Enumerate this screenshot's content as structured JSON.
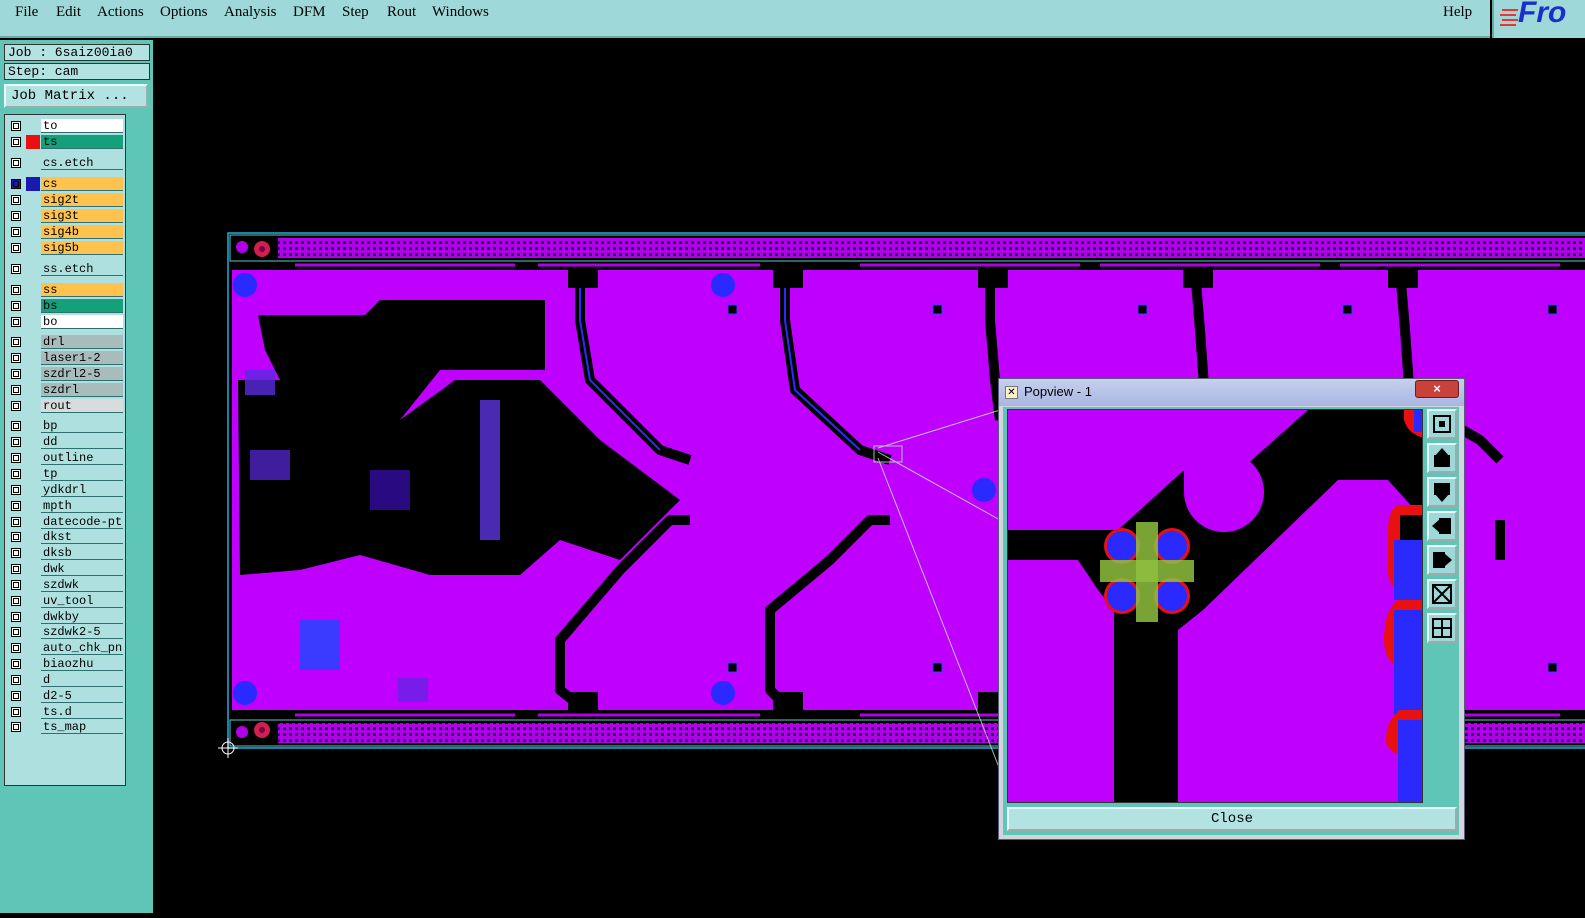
{
  "menubar": {
    "items": [
      {
        "label": "File"
      },
      {
        "label": "Edit"
      },
      {
        "label": "Actions"
      },
      {
        "label": "Options"
      },
      {
        "label": "Analysis"
      },
      {
        "label": "DFM"
      },
      {
        "label": "Step"
      },
      {
        "label": "Rout"
      },
      {
        "label": "Windows"
      }
    ],
    "help": "Help",
    "logo_text": "Fro"
  },
  "left_panel": {
    "job_label": "Job : 6saiz00ia0",
    "step_label": "Step: cam",
    "job_matrix_button": "Job Matrix ..."
  },
  "layers": [
    {
      "name": "to",
      "color": "#ffffff"
    },
    {
      "name": "ts",
      "color": "#13a07a"
    },
    {
      "name": "cs.etch",
      "color": "#aee0e0"
    },
    {
      "name": "cs",
      "color": "#ffc24d"
    },
    {
      "name": "sig2t",
      "color": "#ffc24d"
    },
    {
      "name": "sig3t",
      "color": "#ffc24d"
    },
    {
      "name": "sig4b",
      "color": "#ffc24d"
    },
    {
      "name": "sig5b",
      "color": "#ffc24d"
    },
    {
      "name": "ss.etch",
      "color": "#aee0e0"
    },
    {
      "name": "ss",
      "color": "#ffc24d"
    },
    {
      "name": "bs",
      "color": "#13a07a"
    },
    {
      "name": "bo",
      "color": "#ffffff"
    },
    {
      "name": "drl",
      "color": "#a9bcbc"
    },
    {
      "name": "laser1-2",
      "color": "#a9bcbc"
    },
    {
      "name": "szdrl2-5",
      "color": "#a9bcbc"
    },
    {
      "name": "szdrl",
      "color": "#a9bcbc"
    },
    {
      "name": "rout",
      "color": "#d9dcdc"
    },
    {
      "name": "bp",
      "color": "#aee0e0"
    },
    {
      "name": "dd",
      "color": "#aee0e0"
    },
    {
      "name": "outline",
      "color": "#aee0e0"
    },
    {
      "name": "tp",
      "color": "#aee0e0"
    },
    {
      "name": "ydkdrl",
      "color": "#aee0e0"
    },
    {
      "name": "mpth",
      "color": "#aee0e0"
    },
    {
      "name": "datecode-ptc",
      "color": "#aee0e0"
    },
    {
      "name": "dkst",
      "color": "#aee0e0"
    },
    {
      "name": "dksb",
      "color": "#aee0e0"
    },
    {
      "name": "dwk",
      "color": "#aee0e0"
    },
    {
      "name": "szdwk",
      "color": "#aee0e0"
    },
    {
      "name": "uv_tool",
      "color": "#aee0e0"
    },
    {
      "name": "dwkby",
      "color": "#aee0e0"
    },
    {
      "name": "szdwk2-5",
      "color": "#aee0e0"
    },
    {
      "name": "auto_chk_pnl",
      "color": "#aee0e0"
    },
    {
      "name": "biaozhu",
      "color": "#aee0e0"
    },
    {
      "name": "d",
      "color": "#aee0e0"
    },
    {
      "name": "d2-5",
      "color": "#aee0e0"
    },
    {
      "name": "ts.d",
      "color": "#aee0e0"
    },
    {
      "name": "ts_map",
      "color": "#aee0e0"
    }
  ],
  "popview": {
    "title": "Popview - 1",
    "close_x": "×",
    "close_button": "Close"
  },
  "colors": {
    "board_fill": "#c000ff",
    "pad_blue": "#2a2aff",
    "panel_teal": "#5fc5b6",
    "menu_bg": "#9fd8d8"
  }
}
